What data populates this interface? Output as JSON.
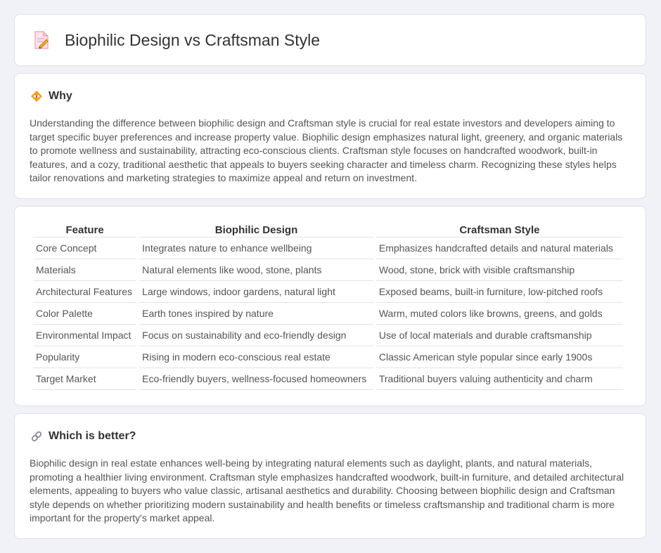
{
  "header": {
    "title": "Biophilic Design vs Craftsman Style",
    "icon": "document-pencil-icon"
  },
  "why": {
    "icon": "diamond-bullet-icon",
    "title": "Why",
    "text": "Understanding the difference between biophilic design and Craftsman style is crucial for real estate investors and developers aiming to target specific buyer preferences and increase property value. Biophilic design emphasizes natural light, greenery, and organic materials to promote wellness and sustainability, attracting eco-conscious clients. Craftsman style focuses on handcrafted woodwork, built-in features, and a cozy, traditional aesthetic that appeals to buyers seeking character and timeless charm. Recognizing these styles helps tailor renovations and marketing strategies to maximize appeal and return on investment."
  },
  "comparison": {
    "headers": [
      "Feature",
      "Biophilic Design",
      "Craftsman Style"
    ],
    "rows": [
      [
        "Core Concept",
        "Integrates nature to enhance wellbeing",
        "Emphasizes handcrafted details and natural materials"
      ],
      [
        "Materials",
        "Natural elements like wood, stone, plants",
        "Wood, stone, brick with visible craftsmanship"
      ],
      [
        "Architectural Features",
        "Large windows, indoor gardens, natural light",
        "Exposed beams, built-in furniture, low-pitched roofs"
      ],
      [
        "Color Palette",
        "Earth tones inspired by nature",
        "Warm, muted colors like browns, greens, and golds"
      ],
      [
        "Environmental Impact",
        "Focus on sustainability and eco-friendly design",
        "Use of local materials and durable craftsmanship"
      ],
      [
        "Popularity",
        "Rising in modern eco-conscious real estate",
        "Classic American style popular since early 1900s"
      ],
      [
        "Target Market",
        "Eco-friendly buyers, wellness-focused homeowners",
        "Traditional buyers valuing authenticity and charm"
      ]
    ]
  },
  "better": {
    "icon": "link-icon",
    "title": "Which is better?",
    "text": "Biophilic design in real estate enhances well-being by integrating natural elements such as daylight, plants, and natural materials, promoting a healthier living environment. Craftsman style emphasizes handcrafted woodwork, built-in furniture, and detailed architectural elements, appealing to buyers who value classic, artisanal aesthetics and durability. Choosing between biophilic design and Craftsman style depends on whether prioritizing modern sustainability and health benefits or timeless craftsmanship and traditional charm is more important for the property's market appeal."
  },
  "colors": {
    "background": "#f0f2f7",
    "card": "#ffffff",
    "accent_orange": "#f0a020",
    "icon_pink": "#f4a7b9"
  }
}
